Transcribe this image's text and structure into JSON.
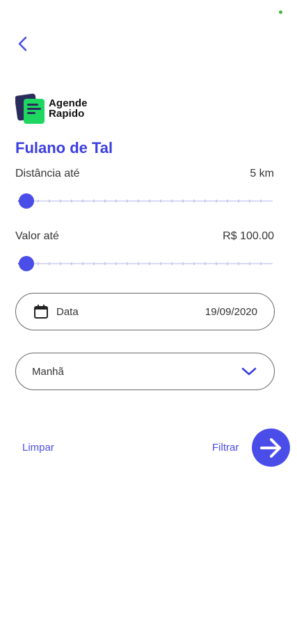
{
  "header": {
    "back_icon": "chevron-left-icon"
  },
  "brand": {
    "line1": "Agende",
    "line2": "Rapido",
    "colors": {
      "dark": "#2a2d5c",
      "green": "#1ed760"
    }
  },
  "profile": {
    "name": "Fulano de Tal"
  },
  "filters": {
    "distance": {
      "label": "Distância até",
      "value": "5 km",
      "level": 0.0
    },
    "price": {
      "label": "Valor até",
      "value": "R$ 100.00",
      "level": 0.0
    },
    "date": {
      "label": "Data",
      "value": "19/09/2020",
      "icon": "calendar-icon"
    },
    "period": {
      "selected": "Manhã",
      "icon": "chevron-down-icon"
    }
  },
  "actions": {
    "clear_label": "Limpar",
    "filter_label": "Filtrar",
    "go_icon": "arrow-right-icon"
  },
  "theme": {
    "accent": "#4a4de8",
    "title": "#3b3ee0"
  }
}
